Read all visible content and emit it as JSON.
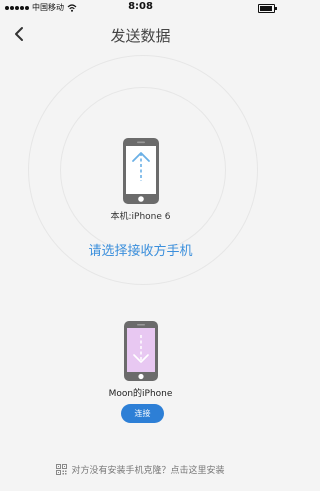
{
  "status_bar": {
    "carrier": "中国移动",
    "time": "8:08"
  },
  "nav": {
    "title": "发送数据"
  },
  "local_device": {
    "label": "本机:iPhone 6"
  },
  "prompt": "请选择接收方手机",
  "remote_device": {
    "name": "Moon的iPhone",
    "connect_label": "连接"
  },
  "footer": {
    "text": "对方没有安装手机克隆？点击这里安装"
  },
  "colors": {
    "accent": "#2d7fd6",
    "prompt": "#3b8fdc",
    "remote_screen": "#e8c8f2",
    "arrow": "#6ab0e6"
  }
}
